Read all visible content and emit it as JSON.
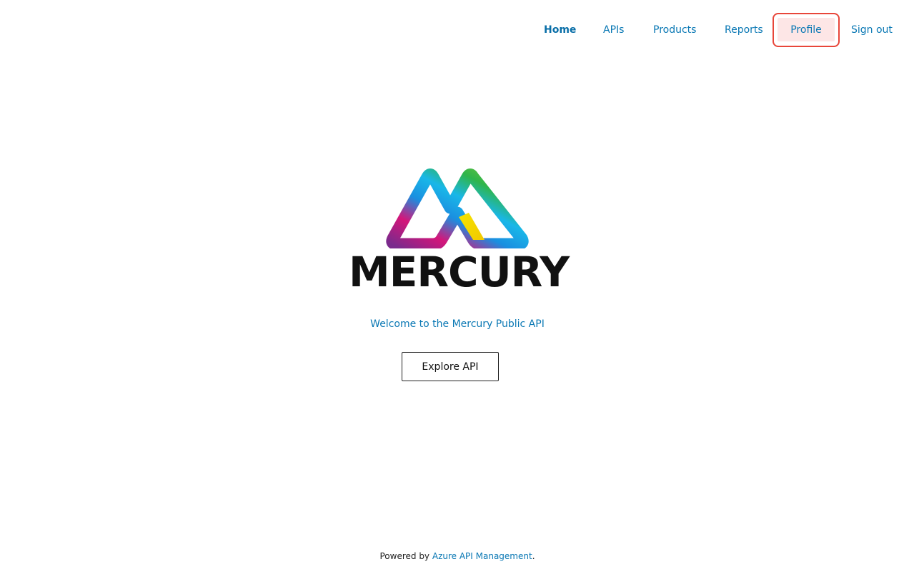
{
  "nav": {
    "items": [
      {
        "label": "Home",
        "active": true
      },
      {
        "label": "APIs"
      },
      {
        "label": "Products"
      },
      {
        "label": "Reports"
      },
      {
        "label": "Profile",
        "highlighted": true
      },
      {
        "label": "Sign out"
      }
    ]
  },
  "logo": {
    "icon": "mercury-mountain-logo-icon",
    "text": "MERCURY"
  },
  "hero": {
    "welcome": "Welcome to the Mercury Public API",
    "button_label": "Explore API"
  },
  "footer": {
    "prefix": "Powered by ",
    "link_label": "Azure API Management",
    "suffix": "."
  },
  "colors": {
    "link": "#0a78b4",
    "highlight_border": "#e8463a",
    "highlight_fill": "#fde6e6",
    "text": "#111111"
  }
}
